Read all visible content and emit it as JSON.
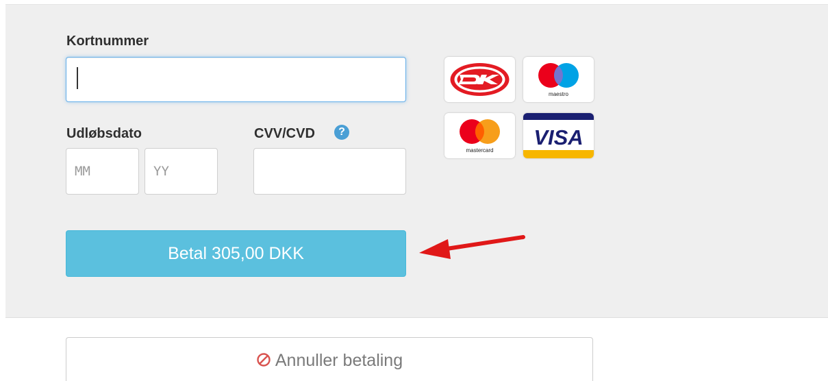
{
  "form": {
    "card_number_label": "Kortnummer",
    "card_number_value": "",
    "expiry_label": "Udløbsdato",
    "expiry_month_placeholder": "MM",
    "expiry_year_placeholder": "YY",
    "cvv_label": "CVV/CVD",
    "cvv_help_glyph": "?",
    "cvv_value": ""
  },
  "pay_button": {
    "label": "Betal 305,00 DKK"
  },
  "cancel_button": {
    "label": "Annuller betaling",
    "icon": "ban-icon"
  },
  "card_logos": [
    {
      "name": "dankort",
      "text": "DK"
    },
    {
      "name": "maestro",
      "text": "maestro"
    },
    {
      "name": "mastercard",
      "text": "mastercard"
    },
    {
      "name": "visa",
      "text": "VISA"
    }
  ],
  "colors": {
    "panel_bg": "#efefef",
    "pay_button": "#5bc0de",
    "help_icon": "#4a9fd5",
    "cancel_icon": "#d9534f",
    "arrow": "#e01818",
    "focus_border": "#66afe9"
  }
}
